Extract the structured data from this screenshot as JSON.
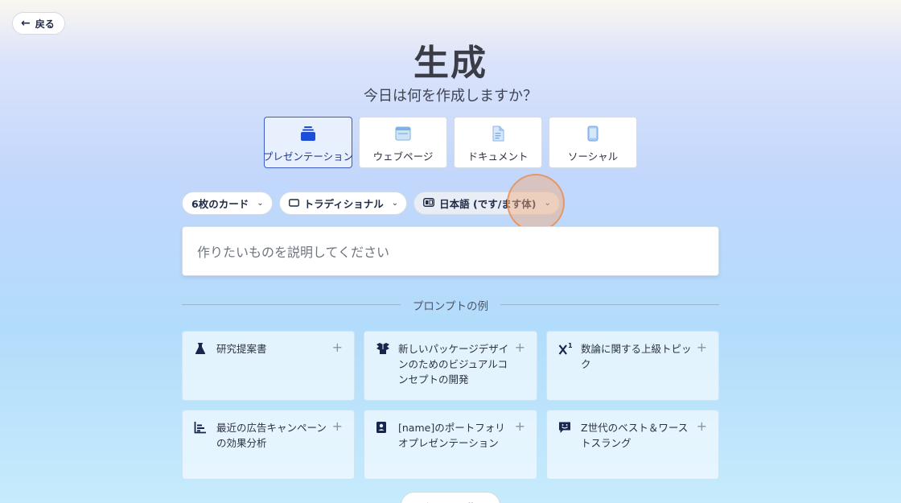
{
  "header": {
    "back_label": "戻る",
    "title": "生成",
    "subtitle": "今日は何を作成しますか？"
  },
  "types": [
    {
      "label": "プレゼンテーション",
      "icon": "stack-icon",
      "active": true
    },
    {
      "label": "ウェブページ",
      "icon": "browser-icon",
      "active": false
    },
    {
      "label": "ドキュメント",
      "icon": "document-icon",
      "active": false
    },
    {
      "label": "ソーシャル",
      "icon": "phone-icon",
      "active": false
    }
  ],
  "options": {
    "cards": "6枚のカード",
    "format": "トラディショナル",
    "language": "日本語 (です/ます体)"
  },
  "prompt": {
    "placeholder": "作りたいものを説明してください"
  },
  "examples_heading": "プロンプトの例",
  "examples": [
    {
      "text": "研究提案書",
      "icon": "flask-icon"
    },
    {
      "text": "新しいパッケージデザインのためのビジュアルコンセプトの開発",
      "icon": "box-icon"
    },
    {
      "text": "数論に関する上級トピック",
      "icon": "superscript-icon"
    },
    {
      "text": "最近の広告キャンペーンの効果分析",
      "icon": "bar-chart-icon"
    },
    {
      "text": "[name]のポートフォリオプレゼンテーション",
      "icon": "portfolio-icon"
    },
    {
      "text": "Z世代のベスト＆ワーストスラング",
      "icon": "chat-emoji-icon"
    }
  ],
  "shuffle_label": "シャッフル",
  "colors": {
    "accent": "#1d4ed8",
    "active_border": "#3b5cc9",
    "icon_dark": "#17264d"
  }
}
